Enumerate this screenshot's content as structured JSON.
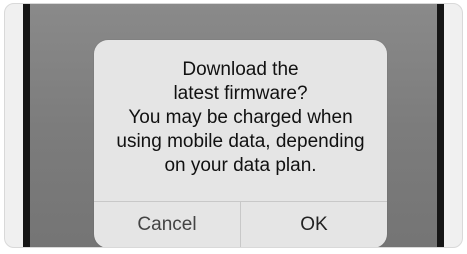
{
  "dialog": {
    "message_lines": [
      "Download the",
      "latest firmware?",
      "You may be charged when",
      "using mobile data, depending",
      "on your data plan."
    ],
    "cancel_label": "Cancel",
    "ok_label": "OK"
  }
}
